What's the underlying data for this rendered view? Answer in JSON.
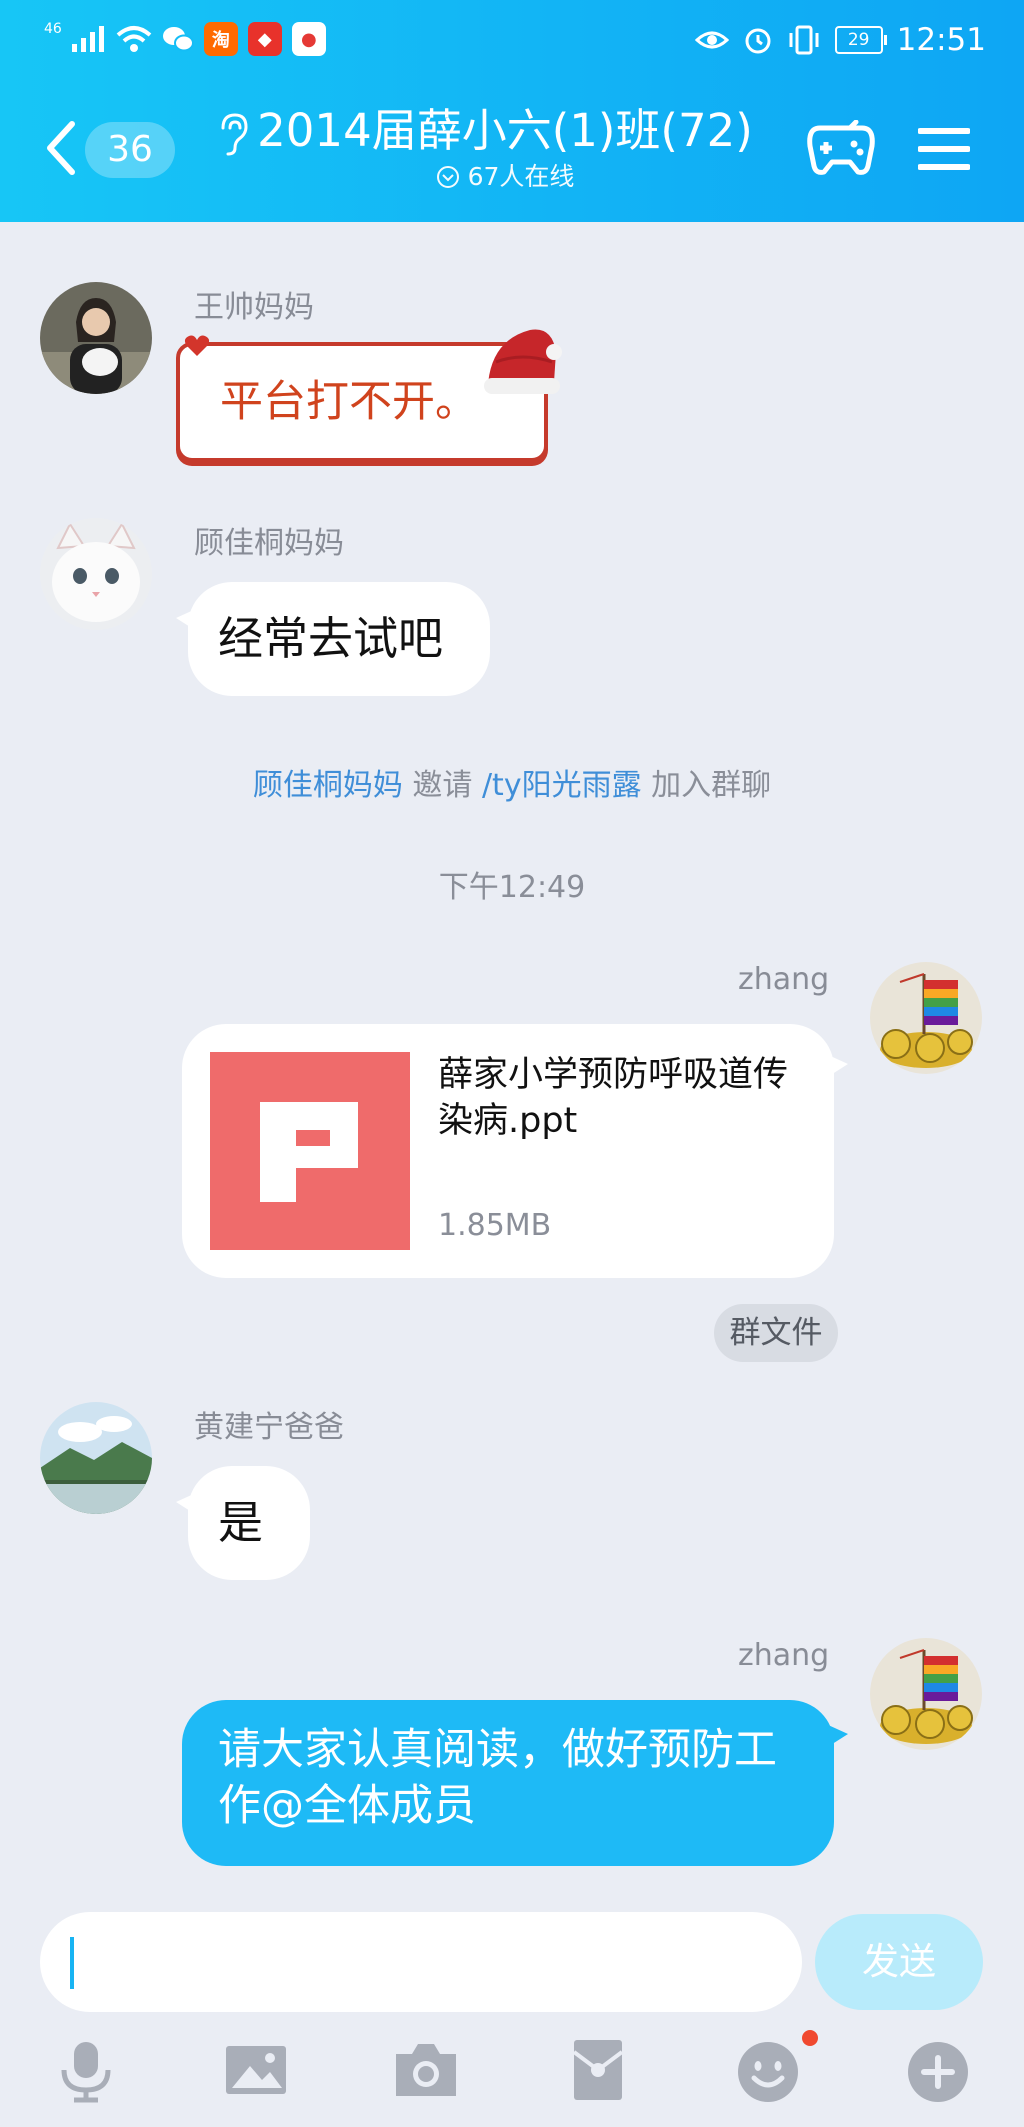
{
  "status_bar": {
    "network": "46",
    "battery": "29",
    "time": "12:51",
    "icons": [
      "signal-icon",
      "wifi-icon",
      "wechat-icon",
      "taobao-icon",
      "app-icon",
      "map-icon",
      "eye-icon",
      "alarm-icon",
      "vibrate-icon",
      "battery-icon"
    ]
  },
  "header": {
    "unread_count": "36",
    "title": "2014届薛小六(1)班(72)",
    "online_text": "67人在线",
    "accent": "#12b4f5"
  },
  "messages": {
    "m1": {
      "sender": "王帅妈妈",
      "text": "平台打不开。"
    },
    "m2": {
      "sender": "顾佳桐妈妈",
      "text": "经常去试吧"
    },
    "system": {
      "inviter": "顾佳桐妈妈",
      "verb": "邀请",
      "invitee": "/ty阳光雨露",
      "suffix": "加入群聊"
    },
    "timestamp": "下午12:49",
    "m3": {
      "sender": "zhang",
      "file_name": "薛家小学预防呼吸道传染病.ppt",
      "file_size": "1.85MB",
      "tag": "群文件"
    },
    "m4": {
      "sender": "黄建宁爸爸",
      "text": "是"
    },
    "m5": {
      "sender": "zhang",
      "text": "请大家认真阅读，做好预防工作@全体成员"
    }
  },
  "composer": {
    "value": "",
    "send_label": "发送",
    "tools": [
      "microphone-icon",
      "image-icon",
      "camera-icon",
      "red-packet-icon",
      "emoji-icon",
      "plus-icon"
    ]
  }
}
